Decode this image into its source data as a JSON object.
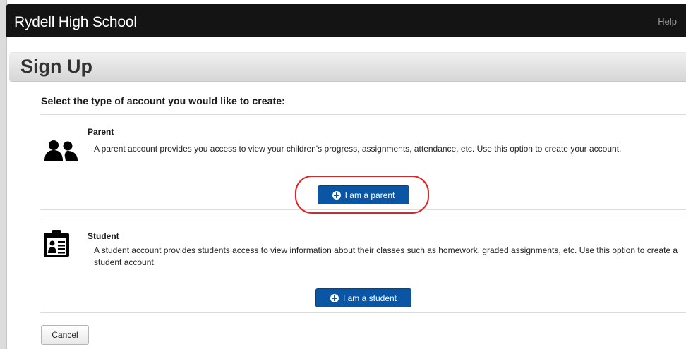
{
  "header": {
    "school_name": "Rydell High School",
    "help_label": "Help"
  },
  "page": {
    "title": "Sign Up",
    "prompt": "Select the type of account you would like to create:"
  },
  "accounts": [
    {
      "icon": "parents-icon",
      "title": "Parent",
      "description": "A parent account provides you access to view your children's progress, assignments, attendance, etc. Use this option to create your account.",
      "button_label": "I am a parent",
      "highlighted": true
    },
    {
      "icon": "student-id-badge-icon",
      "title": "Student",
      "description": "A student account provides students access to view information about their classes such as homework, graded assignments, etc. Use this option to create a student account.",
      "button_label": "I am a student",
      "highlighted": false
    }
  ],
  "actions": {
    "cancel_label": "Cancel"
  },
  "colors": {
    "header_bg": "#141414",
    "primary_button": "#0b56a4",
    "highlight_ring": "#e02222"
  }
}
